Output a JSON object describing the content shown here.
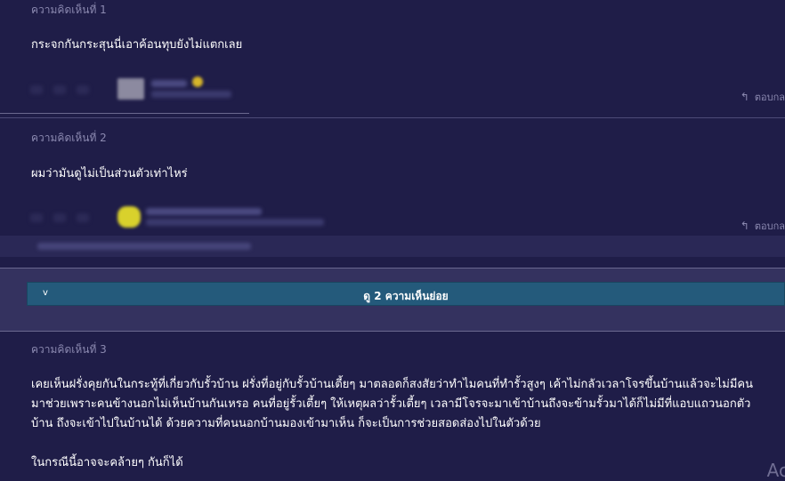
{
  "comments": [
    {
      "label": "ความคิดเห็นที่ 1",
      "text": "กระจกกันกระสุนนี่เอาค้อนทุบยังไม่แตกเลย",
      "reply": "ตอบกล"
    },
    {
      "label": "ความคิดเห็นที่ 2",
      "text": "ผมว่ามันดูไม่เป็นส่วนตัวเท่าไหร่",
      "reply": "ตอบกล"
    },
    {
      "label": "ความคิดเห็นที่ 3",
      "paragraph_lines": [
        "เคยเห็นฝรั่งคุยกันในกระทู้ที่เกี่ยวกับรั้วบ้าน ฝรั่งที่อยู่กับรั้วบ้านเตี้ยๆ มาตลอดก็สงสัยว่าทำไมคนที่ทำรั้วสูงๆ เค้าไม่กลัวเวลาโจรขึ้นบ้านแล้วจะไม่มีคน",
        "มาช่วยเพราะคนข้างนอกไม่เห็นบ้านกันเหรอ คนที่อยู่รั้วเตี้ยๆ ให้เหตุผลว่ารั้วเตี้ยๆ เวลามีโจรจะมาเข้าบ้านถึงจะข้ามรั้วมาได้ก็ไม่มีที่แอบแถวนอกตัว",
        "บ้าน ถึงจะเข้าไปในบ้านได้ ด้วยความที่คนนอกบ้านมองเข้ามาเห็น ก็จะเป็นการช่วยสอดส่องไปในตัวด้วย"
      ],
      "second_paragraph": "ในกรณีนี้อาจจะคล้ายๆ กันก็ได้"
    }
  ],
  "expand_button": {
    "chevron": "v",
    "label": "ดู 2 ความเห็นย่อย"
  },
  "ad_mark": "Ac",
  "icons": {
    "reply": "reply-arrow-icon"
  },
  "colors": {
    "background": "#1f1d48",
    "band": "#2f2d5e",
    "button": "#245a7b",
    "muted_text": "#8b89b0"
  }
}
